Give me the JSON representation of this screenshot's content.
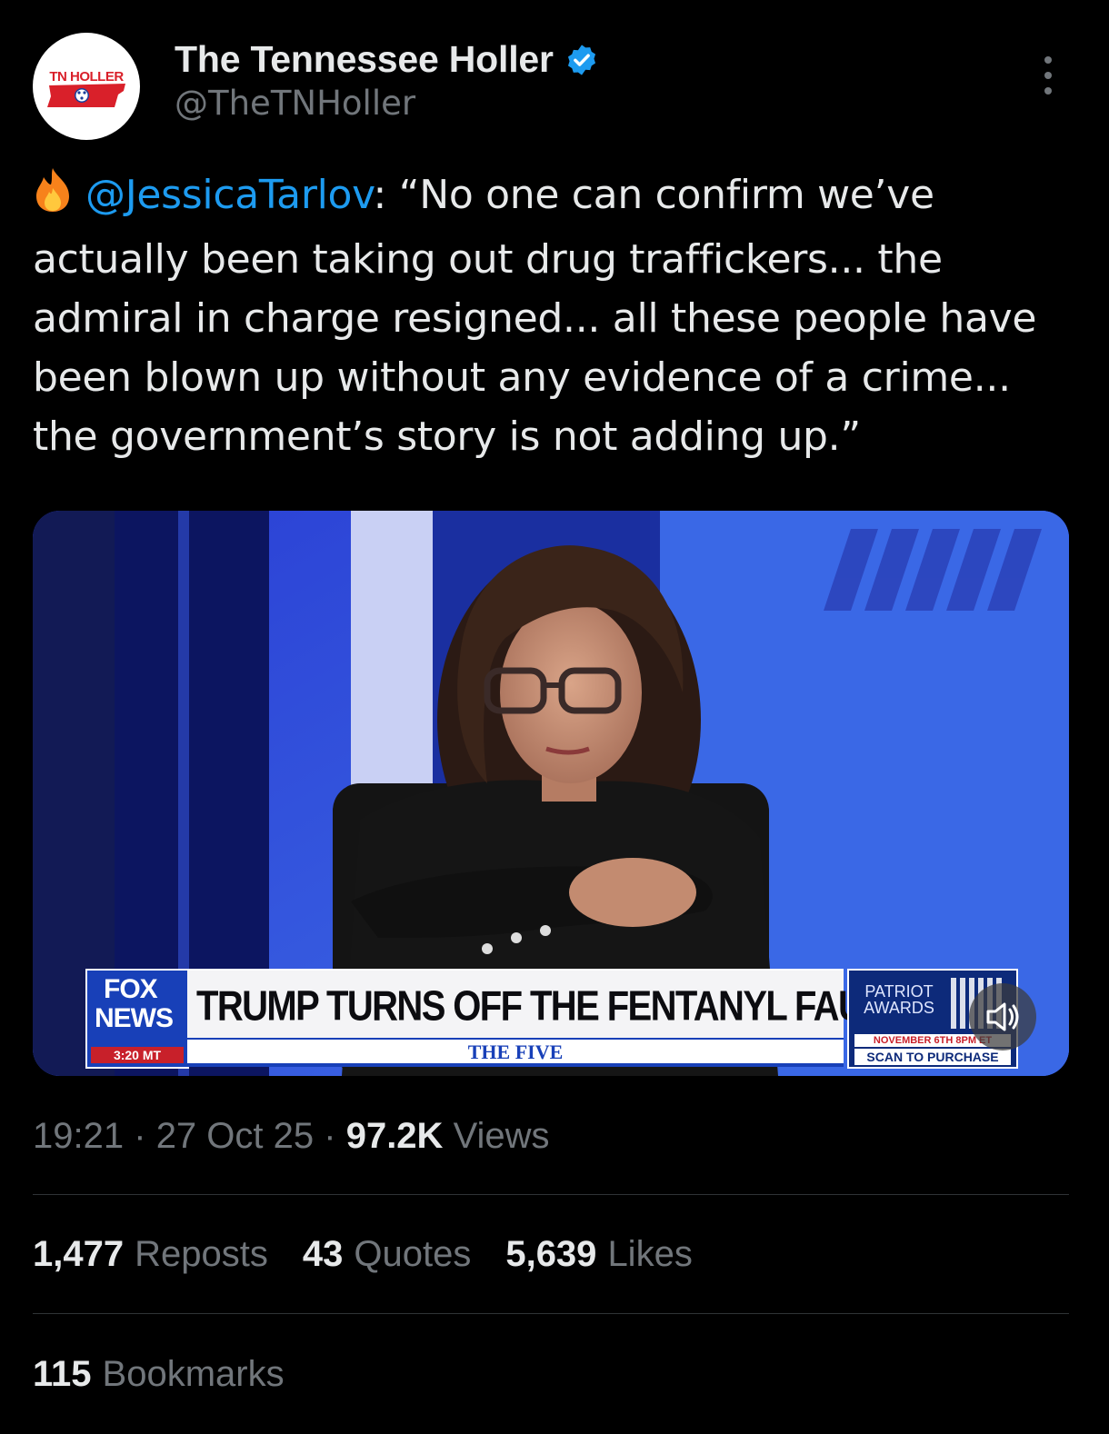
{
  "author": {
    "display_name": "The Tennessee Holler",
    "handle": "@TheTNHoller",
    "avatar_text": "TN HOLLER",
    "verified_icon": "verified-badge-icon",
    "verified_color": "#1d9bf0"
  },
  "more_icon": "more-vertical-icon",
  "tweet": {
    "emoji": "fire-emoji",
    "mention": "@JessicaTarlov",
    "text": ": “No one can confirm we’ve actually been taking out drug traffickers... the admiral in charge resigned... all these people have been blown up without any evidence of a crime... the government’s story is not adding up.”"
  },
  "media": {
    "channel_logo_line1": "FOX",
    "channel_logo_line2": "NEWS",
    "time": "3:20 MT",
    "headline": "TRUMP TURNS OFF THE FENTANYL FAUCET",
    "show_name": "THE FIVE",
    "promo_title": "PATRIOT AWARDS",
    "promo_date": "NOVEMBER 6TH 8PM ET",
    "promo_cta": "SCAN TO PURCHASE",
    "mute_icon": "speaker-muted-icon"
  },
  "meta": {
    "time": "19:21",
    "date": "27 Oct 25",
    "views_count": "97.2K",
    "views_label": "Views",
    "separator": "·"
  },
  "stats": {
    "reposts_count": "1,477",
    "reposts_label": "Reposts",
    "quotes_count": "43",
    "quotes_label": "Quotes",
    "likes_count": "5,639",
    "likes_label": "Likes",
    "bookmarks_count": "115",
    "bookmarks_label": "Bookmarks"
  },
  "colors": {
    "background": "#000000",
    "text": "#e7e9ea",
    "secondary": "#71767b",
    "accent": "#1d9bf0",
    "divider": "#2f3336"
  }
}
